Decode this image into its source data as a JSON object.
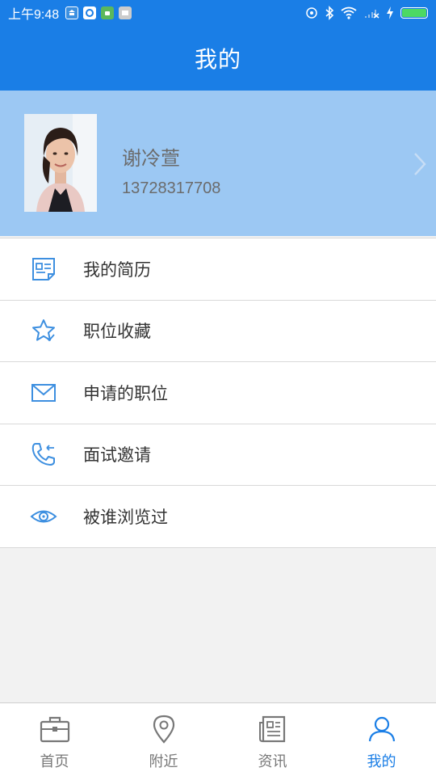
{
  "status_bar": {
    "time": "上午9:48",
    "battery_level": 1.0,
    "colors": {
      "battery": "#4cd964"
    }
  },
  "appbar": {
    "title": "我的"
  },
  "profile": {
    "name": "谢冷萱",
    "phone": "13728317708"
  },
  "menu": {
    "items": [
      {
        "label": "我的简历",
        "icon": "resume-icon"
      },
      {
        "label": "职位收藏",
        "icon": "star-icon"
      },
      {
        "label": "申请的职位",
        "icon": "envelope-icon"
      },
      {
        "label": "面试邀请",
        "icon": "phone-call-icon"
      },
      {
        "label": "被谁浏览过",
        "icon": "eye-icon"
      }
    ]
  },
  "tabbar": {
    "tabs": [
      {
        "label": "首页",
        "icon": "briefcase-icon",
        "active": false
      },
      {
        "label": "附近",
        "icon": "location-pin-icon",
        "active": false
      },
      {
        "label": "资讯",
        "icon": "news-icon",
        "active": false
      },
      {
        "label": "我的",
        "icon": "user-icon",
        "active": true
      }
    ]
  },
  "colors": {
    "primary": "#1a7ee6",
    "profile_bg": "#9cc8f3",
    "inactive": "#777777"
  }
}
